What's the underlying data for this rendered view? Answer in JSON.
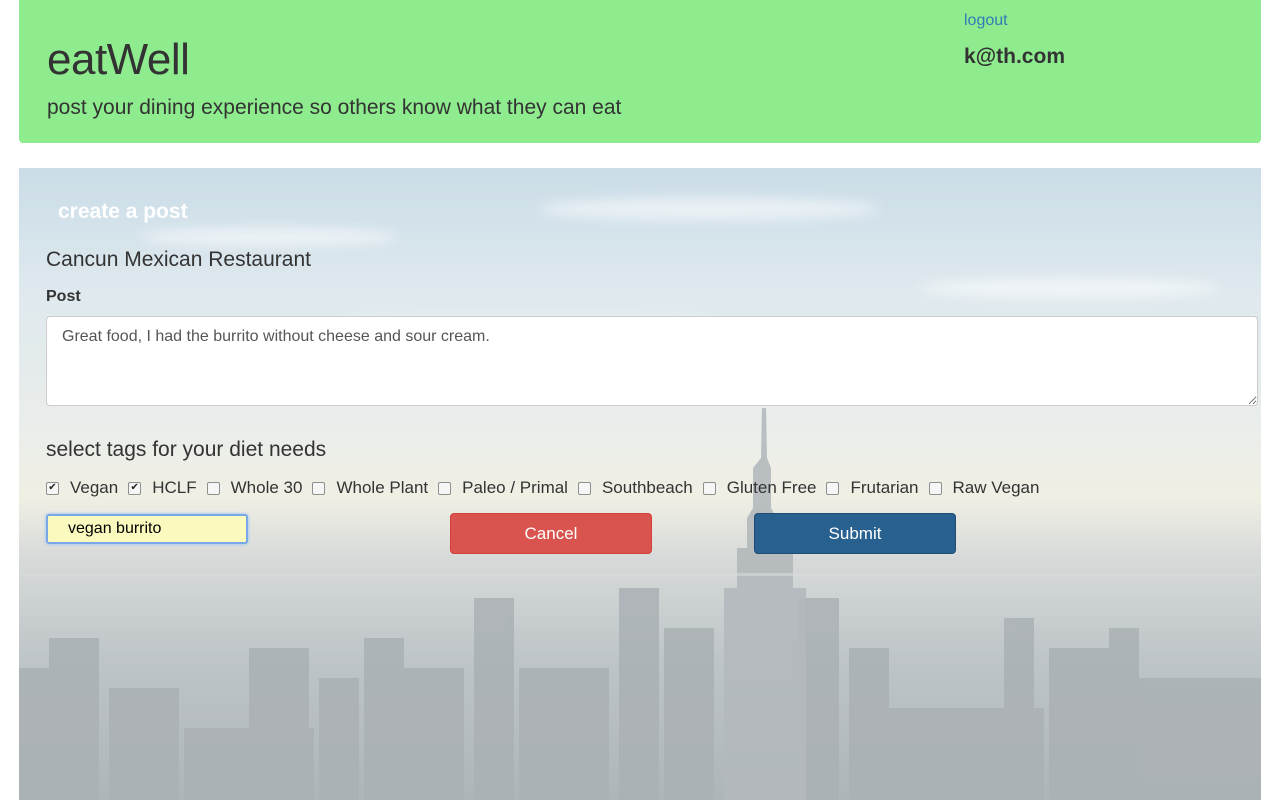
{
  "header": {
    "brand": "eatWell",
    "tagline": "post your dining experience so others know what they can eat",
    "logout_label": "logout",
    "user_email": "k@th.com"
  },
  "form": {
    "section_title": "create a post",
    "restaurant_name": "Cancun Mexican Restaurant",
    "post_label": "Post",
    "post_value": "Great food, I had the burrito without cheese and sour cream.",
    "tags_heading": "select tags for your diet needs",
    "tags": [
      {
        "label": "Vegan",
        "checked": true
      },
      {
        "label": "HCLF",
        "checked": true
      },
      {
        "label": "Whole 30",
        "checked": false
      },
      {
        "label": "Whole Plant",
        "checked": false
      },
      {
        "label": "Paleo / Primal",
        "checked": false
      },
      {
        "label": "Southbeach",
        "checked": false
      },
      {
        "label": "Gluten Free",
        "checked": false
      },
      {
        "label": "Frutarian",
        "checked": false
      },
      {
        "label": "Raw Vegan",
        "checked": false
      }
    ],
    "tag_input_value": "vegan burrito",
    "cancel_label": "Cancel",
    "submit_label": "Submit"
  },
  "colors": {
    "header_bg": "#8eeb8e",
    "link": "#337ab7",
    "cancel": "#d9534f",
    "submit": "#286090"
  }
}
